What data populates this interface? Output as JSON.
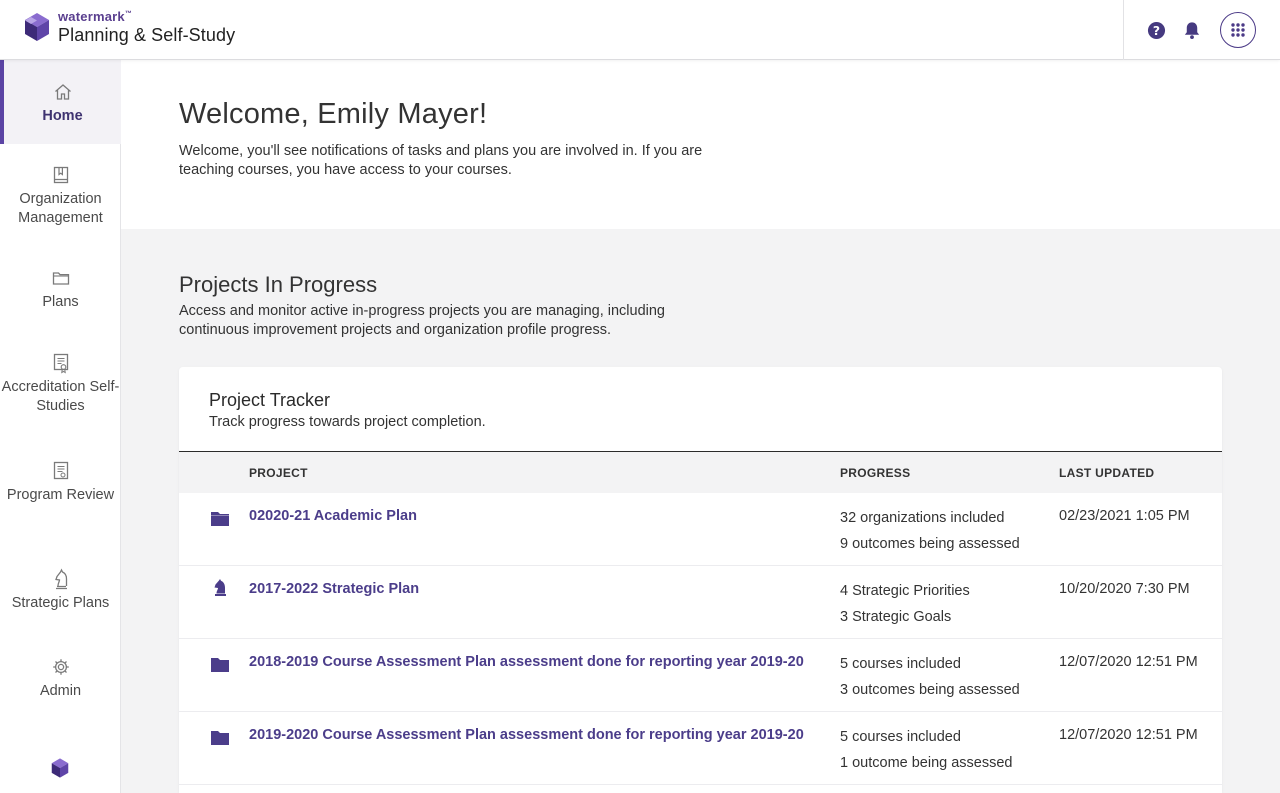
{
  "header": {
    "brand_top": "watermark",
    "brand_tm": "™",
    "product": "Planning & Self-Study",
    "help_icon": "help-icon",
    "bell_icon": "bell-icon",
    "apps_icon": "apps-grid-icon",
    "accent": "#4b3a87"
  },
  "sidebar": {
    "items": [
      {
        "label": "Home",
        "icon": "home-icon"
      },
      {
        "label": "Organization Management",
        "icon": "book-icon"
      },
      {
        "label": "Plans",
        "icon": "folder-icon"
      },
      {
        "label": "Accreditation Self-Studies",
        "icon": "certificate-icon"
      },
      {
        "label": "Program Review",
        "icon": "document-icon"
      },
      {
        "label": "Strategic Plans",
        "icon": "chess-knight-icon"
      },
      {
        "label": "Admin",
        "icon": "gear-icon"
      }
    ],
    "active_color": "#5b44a4"
  },
  "welcome": {
    "title": "Welcome, Emily Mayer!",
    "text": "Welcome, you'll see notifications of tasks and plans you are involved in. If you are teaching courses, you have access to your courses."
  },
  "projects": {
    "title": "Projects In Progress",
    "text": "Access and monitor active in-progress projects you are managing, including continuous improvement projects and organization profile progress."
  },
  "tracker": {
    "title": "Project Tracker",
    "subtitle": "Track progress towards project completion.",
    "columns": {
      "project": "PROJECT",
      "progress": "PROGRESS",
      "updated": "LAST UPDATED"
    },
    "rows": [
      {
        "icon": "folder-icon",
        "name": "02020-21 Academic Plan",
        "progress1": "32 organizations included",
        "progress2": "9 outcomes being assessed",
        "updated": "02/23/2021 1:05 PM"
      },
      {
        "icon": "chess-knight-icon",
        "name": "2017-2022 Strategic Plan",
        "progress1": "4 Strategic Priorities",
        "progress2": "3 Strategic Goals",
        "updated": "10/20/2020 7:30 PM"
      },
      {
        "icon": "folder-icon",
        "name": "2018-2019 Course Assessment Plan assessment done for reporting year 2019-20",
        "progress1": "5 courses included",
        "progress2": "3 outcomes being assessed",
        "updated": "12/07/2020 12:51 PM"
      },
      {
        "icon": "folder-icon",
        "name": "2019-2020 Course Assessment Plan assessment done for reporting year 2019-20",
        "progress1": "5 courses included",
        "progress2": "1 outcome being assessed",
        "updated": "12/07/2020 12:51 PM"
      }
    ],
    "link_color": "#4b3d8a"
  }
}
